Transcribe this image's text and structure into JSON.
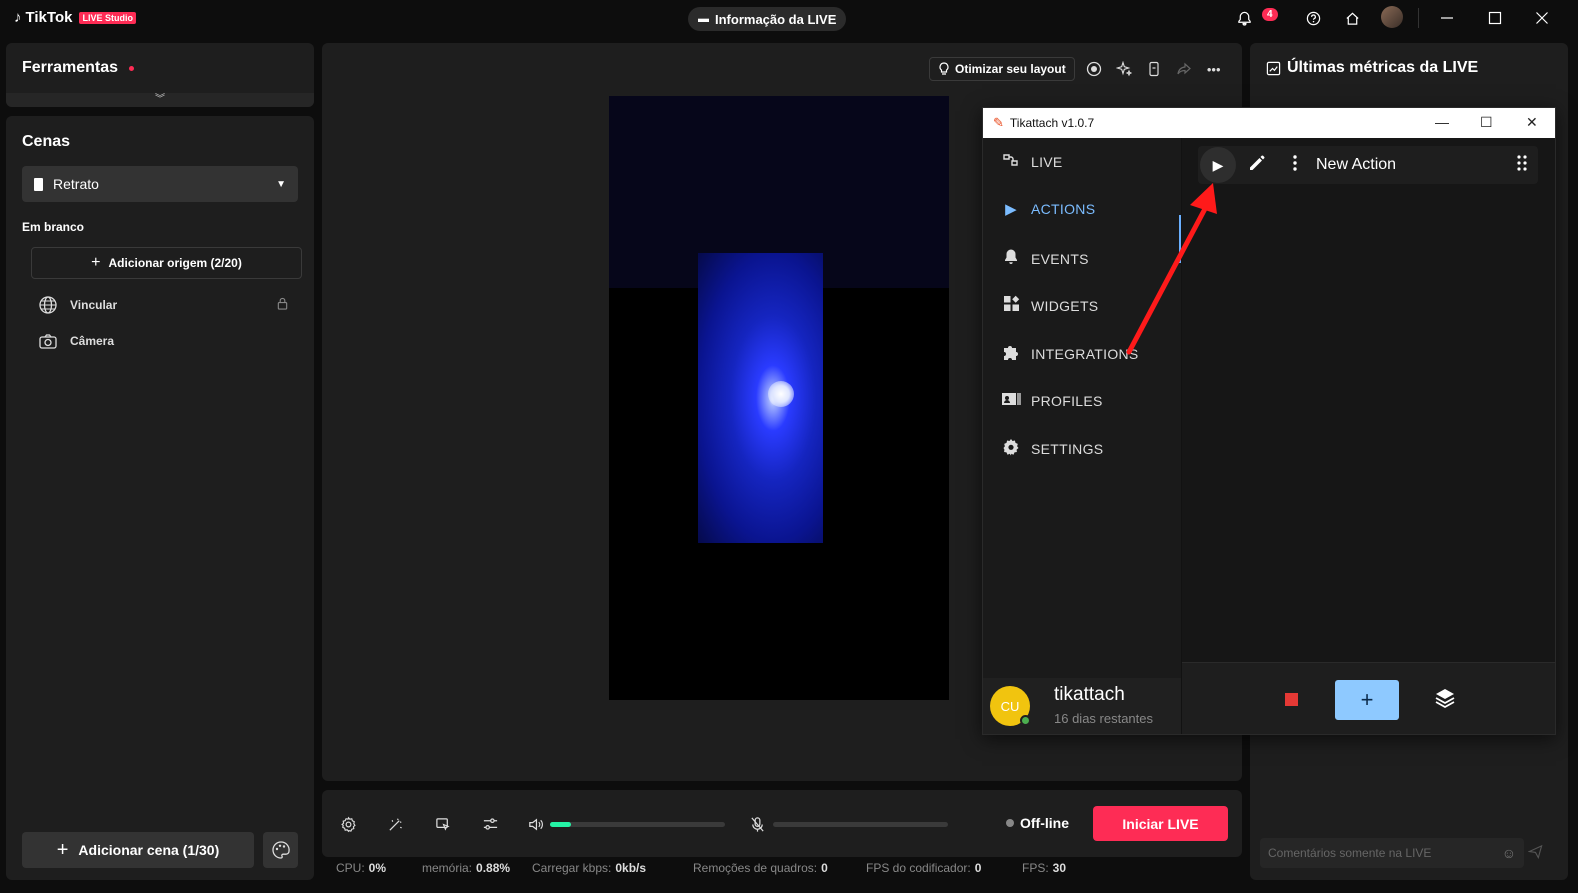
{
  "topbar": {
    "app_name": "TikTok",
    "app_badge": "LIVE Studio",
    "live_info_label": "Informação da LIVE",
    "notification_count": "4",
    "icons": [
      "bell-icon",
      "help-icon",
      "home-icon",
      "avatar",
      "minimize-icon",
      "maximize-icon",
      "close-icon"
    ]
  },
  "tools": {
    "title": "Ferramentas",
    "expand_glyph": "⌄"
  },
  "scenes": {
    "title": "Cenas",
    "selected_scene": "Retrato",
    "group_label": "Em branco",
    "add_source_label": "Adicionar origem (2/20)",
    "sources": [
      {
        "label": "Vincular",
        "icon": "globe-icon",
        "locked": true
      },
      {
        "label": "Câmera",
        "icon": "camera-icon",
        "locked": false
      }
    ],
    "add_scene_label": "Adicionar cena (1/30)"
  },
  "preview": {
    "optimize_label": "Otimizar seu layout"
  },
  "bottombar": {
    "volume_level": 0.12,
    "mic_level": 0,
    "status_label": "Off-line",
    "start_live_label": "Iniciar LIVE"
  },
  "stats": [
    {
      "label": "CPU:",
      "value": "0%"
    },
    {
      "label": "memória:",
      "value": "0.88%"
    },
    {
      "label": "Carregar kbps:",
      "value": "0kb/s"
    },
    {
      "label": "Remoções de quadros:",
      "value": "0"
    },
    {
      "label": "FPS do codificador:",
      "value": "0"
    },
    {
      "label": "FPS:",
      "value": "30"
    }
  ],
  "metrics": {
    "title": "Últimas métricas da LIVE",
    "comment_placeholder": "Comentários somente na LIVE"
  },
  "tikattach": {
    "window_title": "Tikattach v1.0.7",
    "nav": [
      {
        "label": "LIVE",
        "icon": "live-icon"
      },
      {
        "label": "ACTIONS",
        "icon": "play-icon",
        "active": true
      },
      {
        "label": "EVENTS",
        "icon": "bell-icon"
      },
      {
        "label": "WIDGETS",
        "icon": "widgets-icon"
      },
      {
        "label": "INTEGRATIONS",
        "icon": "puzzle-icon"
      },
      {
        "label": "PROFILES",
        "icon": "profile-card-icon"
      },
      {
        "label": "SETTINGS",
        "icon": "gear-icon"
      }
    ],
    "user": {
      "initials": "CU",
      "name": "tikattach",
      "subtitle": "16 dias restantes"
    },
    "actions": [
      {
        "name": "New Action"
      }
    ]
  },
  "colors": {
    "accent": "#fe2c55",
    "volume": "#25f4a6",
    "tika_active": "#7bbcff",
    "tika_add": "#8ec9ff",
    "annotation_arrow": "#ff1a1a"
  }
}
